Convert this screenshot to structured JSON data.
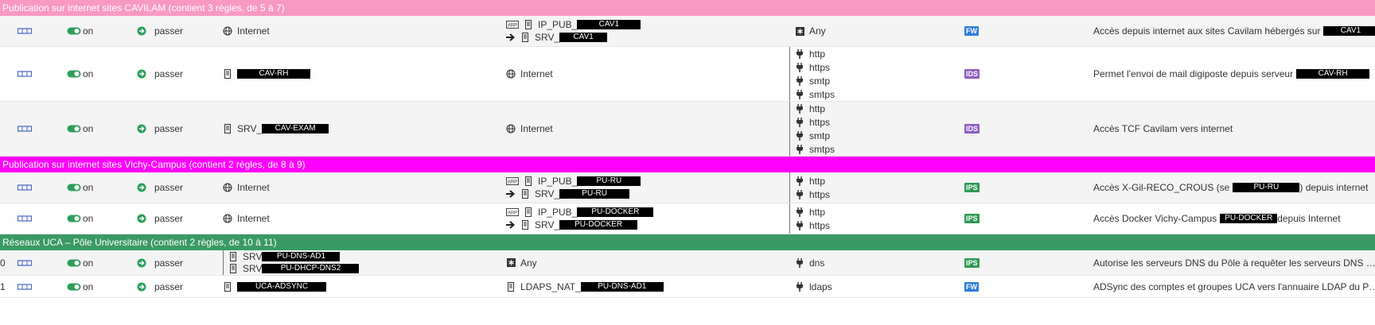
{
  "colors": {
    "group_0": "#f899c3",
    "group_1": "#ff00ff",
    "group_2": "#3a9a62",
    "toggle_on": "#2e9e5b",
    "action_pass": "#2e9e5b"
  },
  "groups": [
    {
      "title": "Publication sur internet sites CAVILAM (contient 3 règles, de 5 à 7)",
      "rules": [
        {
          "num": "",
          "status": "on",
          "action": "passer",
          "source": [
            {
              "icon": "globe-icon",
              "text": "Internet",
              "redact": ""
            }
          ],
          "dest": [
            {
              "prefix_icons": [
                "arp-icon",
                "server-icon"
              ],
              "text": "IP_PUB_",
              "redact": "CAV1",
              "redact_w": 80
            },
            {
              "prefix_icons": [
                "arrow-right-icon",
                "server-icon"
              ],
              "text": "SRV_",
              "redact": "CAV1",
              "redact_w": 60
            }
          ],
          "services": [
            {
              "icon": "asterisk-icon",
              "text": "Any"
            }
          ],
          "inspection": "FW",
          "comment": "Accès depuis internet aux sites Cavilam hébergés sur",
          "comment_redact": "CAV1",
          "comment_redact_w": 68
        },
        {
          "num": "",
          "status": "on",
          "action": "passer",
          "source": [
            {
              "icon": "server-icon",
              "text": "",
              "redact": "CAV-RH",
              "redact_w": 92
            }
          ],
          "dest": [
            {
              "prefix_icons": [
                "globe-icon"
              ],
              "text": "Internet",
              "redact": ""
            }
          ],
          "services": [
            {
              "icon": "plug-icon",
              "text": "http"
            },
            {
              "icon": "plug-icon",
              "text": "https"
            },
            {
              "icon": "plug-icon",
              "text": "smtp"
            },
            {
              "icon": "plug-icon",
              "text": "smtps"
            }
          ],
          "inspection": "IDS",
          "comment": "Permet l'envoi de mail digiposte depuis serveur",
          "comment_redact": "CAV-RH",
          "comment_redact_w": 92
        },
        {
          "num": "",
          "status": "on",
          "action": "passer",
          "source": [
            {
              "icon": "server-icon",
              "text": "SRV_",
              "redact": "CAV-EXAM",
              "redact_w": 84
            }
          ],
          "dest": [
            {
              "prefix_icons": [
                "globe-icon"
              ],
              "text": "Internet",
              "redact": ""
            }
          ],
          "services": [
            {
              "icon": "plug-icon",
              "text": "http"
            },
            {
              "icon": "plug-icon",
              "text": "https"
            },
            {
              "icon": "plug-icon",
              "text": "smtp"
            },
            {
              "icon": "plug-icon",
              "text": "smtps"
            }
          ],
          "inspection": "IDS",
          "comment": "Accès TCF Cavilam vers internet",
          "comment_redact": "",
          "comment_redact_w": 0
        }
      ]
    },
    {
      "title": "Publication sur internet sites Vichy-Campus (contient 2 règles, de 8 à 9)",
      "rules": [
        {
          "num": "",
          "status": "on",
          "action": "passer",
          "source": [
            {
              "icon": "globe-icon",
              "text": "Internet",
              "redact": ""
            }
          ],
          "dest": [
            {
              "prefix_icons": [
                "arp-icon",
                "server-icon"
              ],
              "text": "IP_PUB_",
              "redact": "PU-RU",
              "redact_w": 80
            },
            {
              "prefix_icons": [
                "arrow-right-icon",
                "server-icon"
              ],
              "text": "SRV_",
              "redact": "PU-RU",
              "redact_w": 88
            }
          ],
          "services": [
            {
              "icon": "plug-icon",
              "text": "http"
            },
            {
              "icon": "plug-icon",
              "text": "https"
            }
          ],
          "inspection": "IPS",
          "comment": "Accès X-Gil-RECO_CROUS (se",
          "comment_redact": "PU-RU",
          "comment_redact_w": 84,
          "comment_after": ") depuis internet"
        },
        {
          "num": "",
          "status": "on",
          "action": "passer",
          "source": [
            {
              "icon": "globe-icon",
              "text": "Internet",
              "redact": ""
            }
          ],
          "dest": [
            {
              "prefix_icons": [
                "arp-icon",
                "server-icon"
              ],
              "text": "IP_PUB_",
              "redact": "PU-DOCKER",
              "redact_w": 96
            },
            {
              "prefix_icons": [
                "arrow-right-icon",
                "server-icon"
              ],
              "text": "SRV_",
              "redact": "PU-DOCKER",
              "redact_w": 98
            }
          ],
          "services": [
            {
              "icon": "plug-icon",
              "text": "http"
            },
            {
              "icon": "plug-icon",
              "text": "https"
            }
          ],
          "inspection": "IPS",
          "comment": "Accès Docker Vichy-Campus",
          "comment_redact": "PU-DOCKER",
          "comment_redact_w": 72,
          "comment_after": "depuis Internet"
        }
      ]
    },
    {
      "title": "Réseaux UCA – Pôle Universitaire (contient 2 règles, de 10 à 11)",
      "rules": [
        {
          "num": "0",
          "status": "on",
          "action": "passer",
          "source_bar": true,
          "source": [
            {
              "icon": "server-icon",
              "text": "SRV",
              "redact": "PU-DNS-AD1",
              "redact_w": 98
            },
            {
              "icon": "server-icon",
              "text": "SRV",
              "redact": "PU-DHCP-DNS2",
              "redact_w": 122
            }
          ],
          "dest": [
            {
              "prefix_icons": [
                "asterisk-icon"
              ],
              "text": "Any",
              "redact": ""
            }
          ],
          "services": [
            {
              "icon": "plug-icon",
              "text": "dns"
            }
          ],
          "services_nobar": true,
          "inspection": "IPS",
          "comment": "Autorise les serveurs DNS du Pôle à requêter les serveurs DNS …",
          "comment_redact": "",
          "comment_redact_w": 0
        },
        {
          "num": "1",
          "status": "on",
          "action": "passer",
          "source": [
            {
              "icon": "server-icon",
              "text": "",
              "redact": "UCA-ADSYNC",
              "redact_w": 112
            }
          ],
          "dest": [
            {
              "prefix_icons": [
                "server-icon"
              ],
              "text": "LDAPS_NAT_",
              "redact": "PU-DNS-AD1",
              "redact_w": 104
            }
          ],
          "services": [
            {
              "icon": "plug-icon",
              "text": "ldaps"
            }
          ],
          "services_nobar": true,
          "inspection": "FW",
          "comment": "ADSync des comptes et groupes UCA vers l'annuaire LDAP du P…",
          "comment_redact": "",
          "comment_redact_w": 0
        }
      ]
    }
  ]
}
